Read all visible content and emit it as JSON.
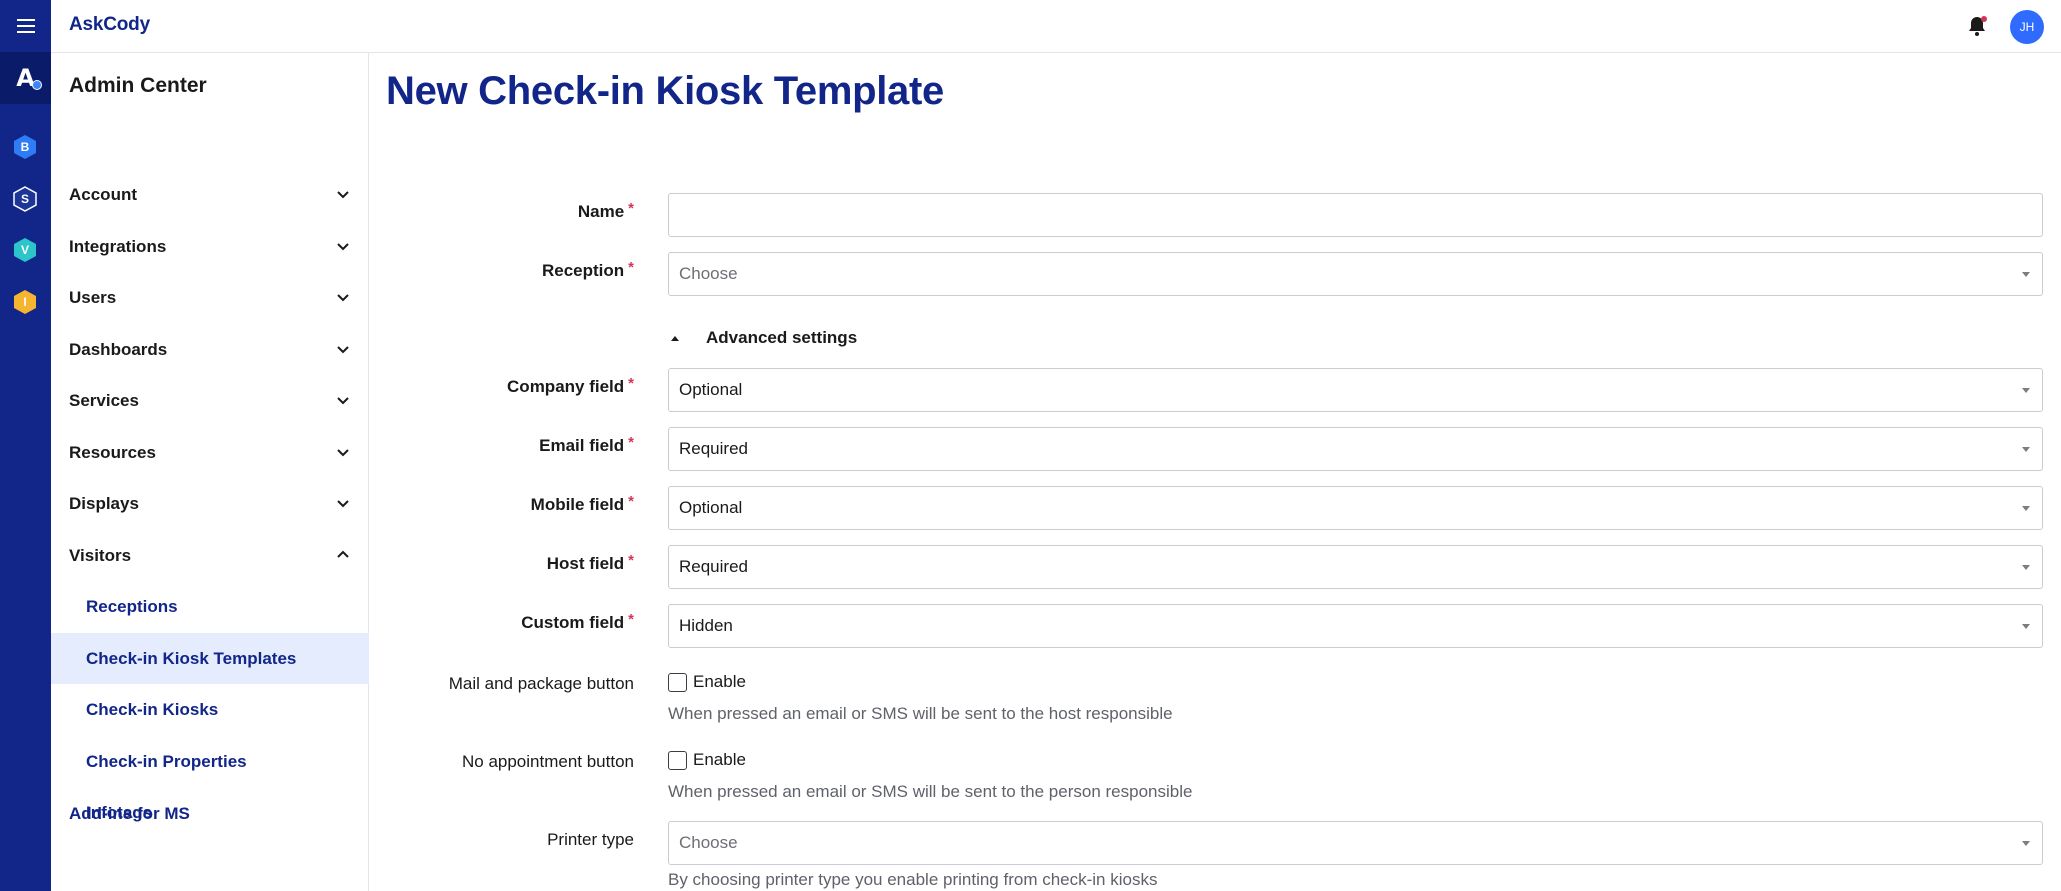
{
  "app": {
    "brand": "AskCody",
    "user_initials": "JH",
    "rail_apps": [
      {
        "letter": "B",
        "color": "#2f7df6"
      },
      {
        "letter": "S",
        "color": "#1d3596"
      },
      {
        "letter": "V",
        "color": "#2cc5c9"
      },
      {
        "letter": "I",
        "color": "#f5b531"
      }
    ]
  },
  "sidebar": {
    "title": "Admin Center",
    "items": [
      {
        "label": "Account"
      },
      {
        "label": "Integrations"
      },
      {
        "label": "Users"
      },
      {
        "label": "Dashboards"
      },
      {
        "label": "Services"
      },
      {
        "label": "Resources"
      },
      {
        "label": "Displays"
      },
      {
        "label": "Visitors"
      }
    ],
    "visitor_subitems": [
      {
        "label": "Receptions"
      },
      {
        "label": "Check-in Kiosk Templates"
      },
      {
        "label": "Check-in Kiosks"
      },
      {
        "label": "Check-in Properties"
      },
      {
        "label": "Infotags"
      }
    ],
    "addins_label": "Add-ins for MS"
  },
  "page": {
    "title": "New Check-in Kiosk Template",
    "form": {
      "name": {
        "label": "Name",
        "required_mark": "*",
        "value": ""
      },
      "reception": {
        "label": "Reception",
        "required_mark": "*",
        "placeholder": "Choose"
      },
      "advanced_label": "Advanced settings",
      "company": {
        "label": "Company field",
        "required_mark": "*",
        "value": "Optional"
      },
      "email": {
        "label": "Email field",
        "required_mark": "*",
        "value": "Required"
      },
      "mobile": {
        "label": "Mobile field",
        "required_mark": "*",
        "value": "Optional"
      },
      "host": {
        "label": "Host field",
        "required_mark": "*",
        "value": "Required"
      },
      "custom": {
        "label": "Custom field",
        "required_mark": "*",
        "value": "Hidden"
      },
      "mail_button": {
        "label": "Mail and package button",
        "checkbox_label": "Enable",
        "hint": "When pressed an email or SMS will be sent to the host responsible"
      },
      "no_appointment": {
        "label": "No appointment button",
        "checkbox_label": "Enable",
        "hint": "When pressed an email or SMS will be sent to the person responsible"
      },
      "printer": {
        "label": "Printer type",
        "placeholder": "Choose",
        "hint": "By choosing printer type you enable printing from check-in kiosks"
      }
    }
  },
  "colors": {
    "rail": "#12268a",
    "accent": "#12268a",
    "active_bg": "#e4ecfd",
    "required": "#d6335a",
    "avatar": "#2f6bff"
  }
}
